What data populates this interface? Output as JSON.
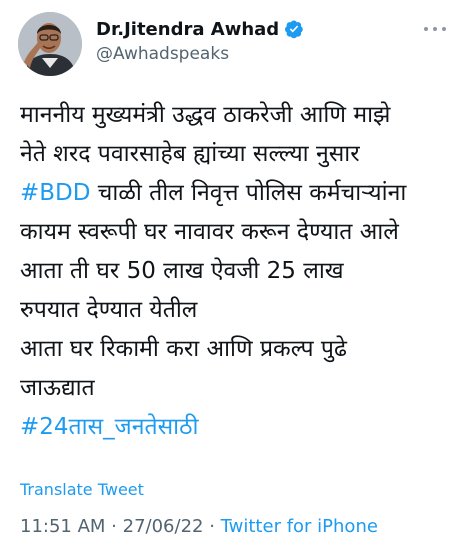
{
  "author": {
    "display_name": "Dr.Jitendra Awhad",
    "handle": "@Awhadspeaks",
    "verified_icon": "verified-badge-icon",
    "avatar_icon": "profile-avatar"
  },
  "menu": {
    "icon": "more-horizontal-icon"
  },
  "tweet": {
    "lines": [
      "माननीय मुख्यमंत्री उद्धव ठाकरेजी आणि माझे",
      "नेते शरद पवारसाहेब ह्यांच्या सल्ल्या नुसार",
      "चाळी तील निवृत्त पोलिस कर्मचाऱ्यांना",
      "कायम स्वरूपी घर नावावर करून देण्यात आले",
      "आता ती घर 50 लाख ऐवजी 25 लाख",
      "रुपयात देण्यात येतील",
      "आता घर रिकामी करा आणि प्रकल्प पुढे",
      "जाऊद्यात"
    ],
    "hashtag_bdd": "#BDD",
    "hashtag_end": "#24तास_जनतेसाठी"
  },
  "translate_label": "Translate Tweet",
  "meta": {
    "time": "11:51 AM",
    "separator": " · ",
    "date": "27/06/22",
    "source": "Twitter for iPhone"
  },
  "colors": {
    "accent": "#1d9bf0",
    "text": "#0f1419",
    "secondary": "#536471"
  }
}
